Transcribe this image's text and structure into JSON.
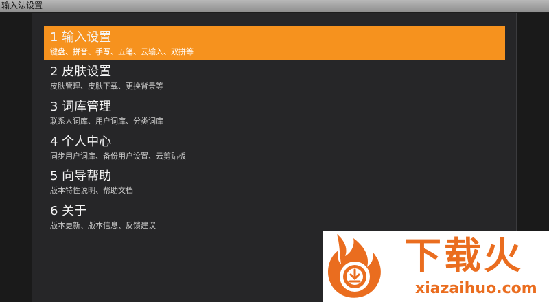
{
  "window": {
    "title": "输入法设置"
  },
  "menu": {
    "items": [
      {
        "title": "1 输入设置",
        "subtitle": "键盘、拼音、手写、五笔、云输入、双拼等",
        "selected": true
      },
      {
        "title": "2 皮肤设置",
        "subtitle": "皮肤管理、皮肤下载、更换背景等",
        "selected": false
      },
      {
        "title": "3 词库管理",
        "subtitle": "联系人词库、用户词库、分类词库",
        "selected": false
      },
      {
        "title": "4 个人中心",
        "subtitle": "同步用户词库、备份用户设置、云剪贴板",
        "selected": false
      },
      {
        "title": "5 向导帮助",
        "subtitle": "版本特性说明、帮助文档",
        "selected": false
      },
      {
        "title": "6 关于",
        "subtitle": "版本更新、版本信息、反馈建议",
        "selected": false
      }
    ]
  },
  "watermark": {
    "brand_cn": "下载火",
    "brand_en": "xiazaihuo.com",
    "logo_icon": "flame-download-icon"
  },
  "colors": {
    "selected_bg": "#f6921e",
    "panel_bg": "#262628",
    "brand": "#ea6d1f"
  }
}
